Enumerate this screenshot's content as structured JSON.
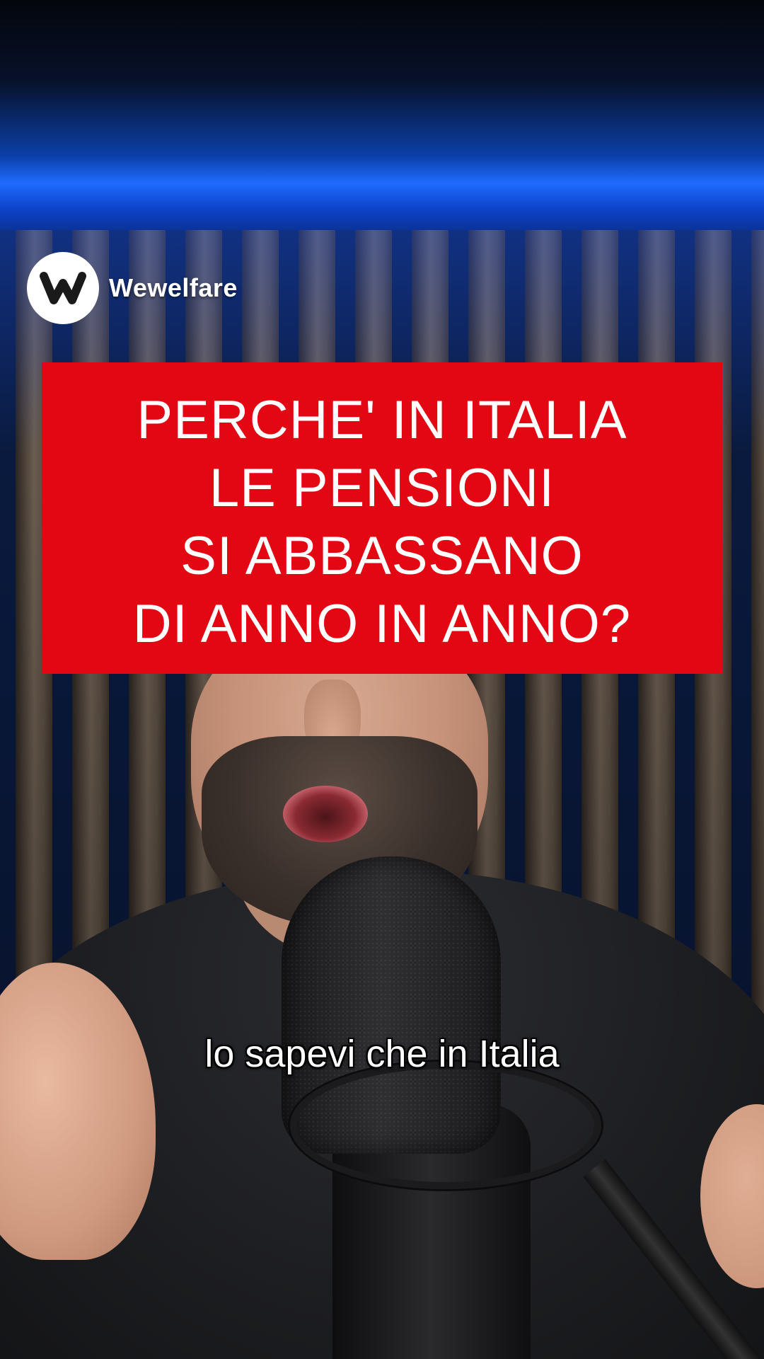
{
  "brand": {
    "name": "Wewelfare",
    "logo_icon": "wewelfare-w-logo-icon"
  },
  "headline": {
    "lines": [
      "PERCHE' IN ITALIA",
      "LE PENSIONI",
      "SI ABBASSANO",
      "DI ANNO IN ANNO?"
    ],
    "background_color": "#e30613",
    "text_color": "#ffffff"
  },
  "caption": {
    "text": "lo sapevi che in Italia"
  }
}
